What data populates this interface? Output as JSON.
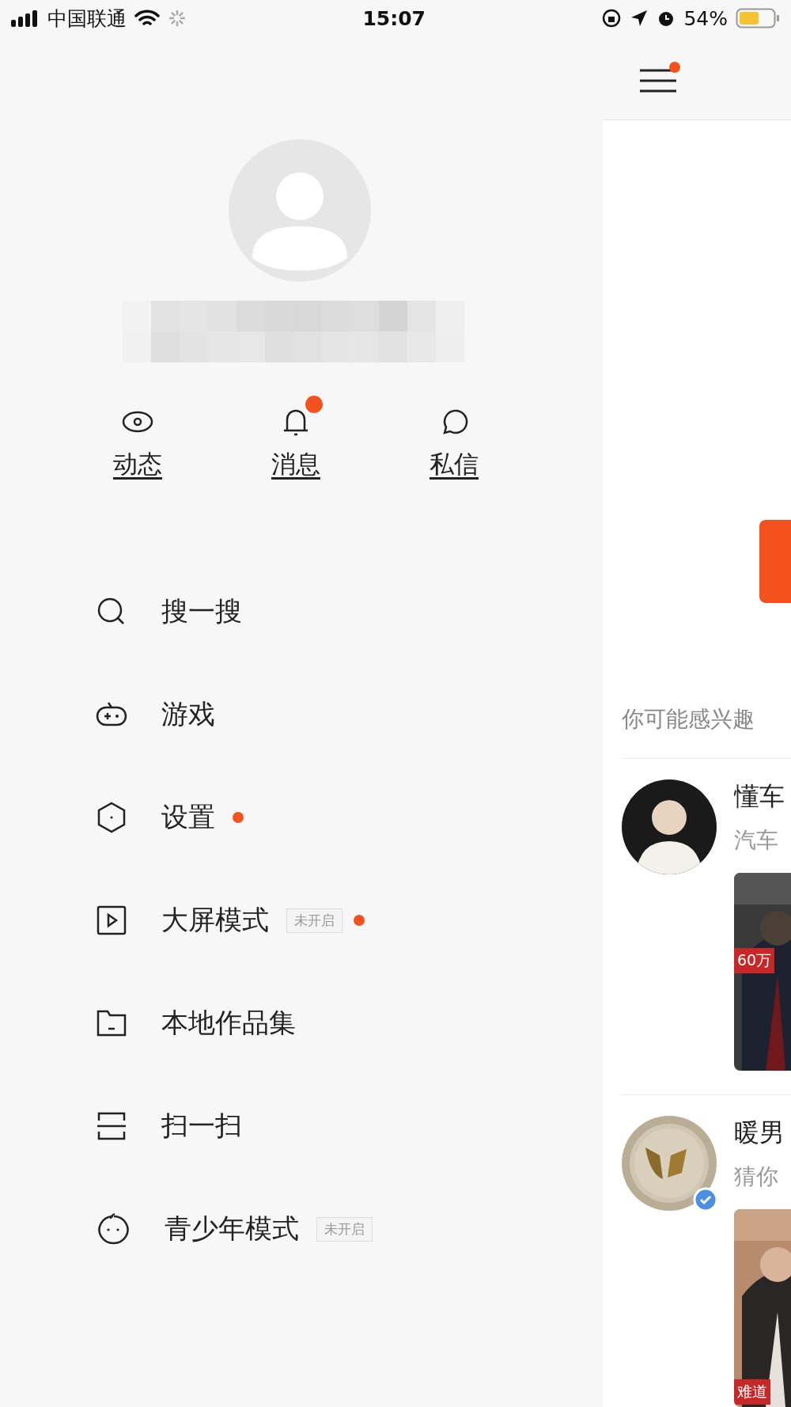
{
  "status_bar": {
    "carrier": "中国联通",
    "time": "15:07",
    "battery": "54%"
  },
  "drawer": {
    "quick_actions": [
      {
        "label": "动态",
        "badge": false
      },
      {
        "label": "消息",
        "badge": true
      },
      {
        "label": "私信",
        "badge": false
      }
    ],
    "menu": [
      {
        "label": "搜一搜",
        "dot": false
      },
      {
        "label": "游戏",
        "dot": false
      },
      {
        "label": "设置",
        "dot": true
      },
      {
        "label": "大屏模式",
        "status_tag": "未开启",
        "dot": true
      },
      {
        "label": "本地作品集",
        "dot": false
      },
      {
        "label": "扫一扫",
        "dot": false
      },
      {
        "label": "青少年模式",
        "status_tag": "未开启",
        "dot": false
      }
    ]
  },
  "feed": {
    "menu_dot": true,
    "section_title": "你可能感兴趣",
    "suggestions": [
      {
        "name": "懂车",
        "subtitle": "汽车",
        "verified": false,
        "video_caption": "60万"
      },
      {
        "name": "暖男",
        "subtitle": "猜你",
        "verified": true,
        "video_caption": "难道"
      }
    ]
  }
}
